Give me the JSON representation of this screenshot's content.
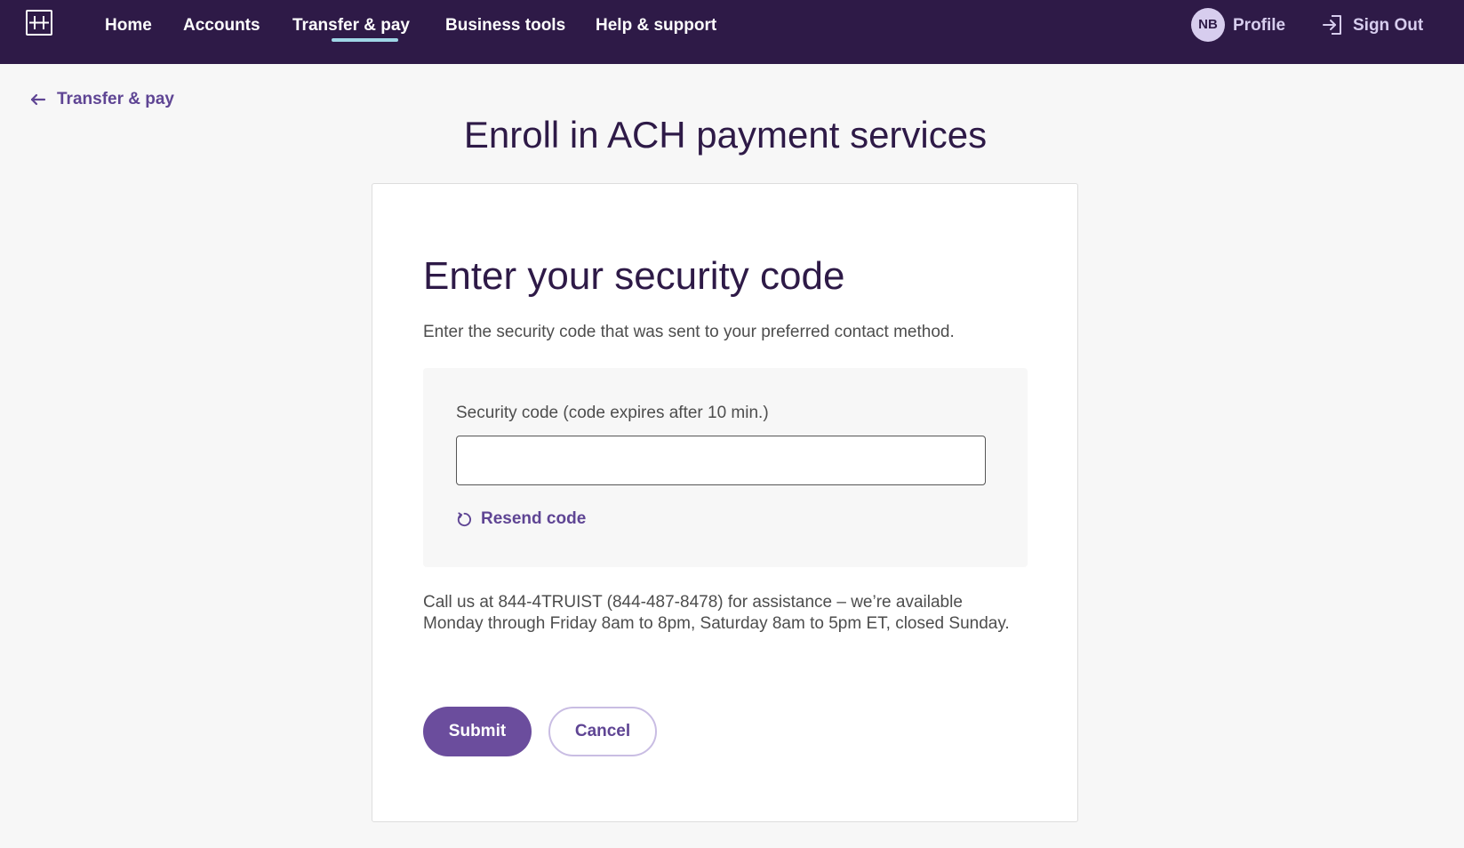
{
  "nav": {
    "items": [
      {
        "label": "Home"
      },
      {
        "label": "Accounts"
      },
      {
        "label": "Transfer & pay"
      },
      {
        "label": "Business tools"
      },
      {
        "label": "Help & support"
      }
    ],
    "active_item": "Transfer & pay",
    "avatar_initials": "NB",
    "profile_label": "Profile",
    "signout_label": "Sign Out"
  },
  "back_link": {
    "label": "Transfer & pay"
  },
  "page_title": "Enroll in ACH payment services",
  "card": {
    "heading": "Enter your security code",
    "description": "Enter the security code that was sent to your preferred contact method.",
    "field_label": "Security code (code expires after 10 min.)",
    "field_value": "",
    "resend_label": "Resend code",
    "help_text": "Call us at 844-4TRUIST (844-487-8478) for assistance – we’re available Monday through Friday 8am to 8pm, Saturday 8am to 5pm ET, closed Sunday.",
    "submit_label": "Submit",
    "cancel_label": "Cancel"
  },
  "colors": {
    "nav_bg": "#2e1a47",
    "accent": "#6b4d9d",
    "active_underline": "#9fd6e6"
  }
}
